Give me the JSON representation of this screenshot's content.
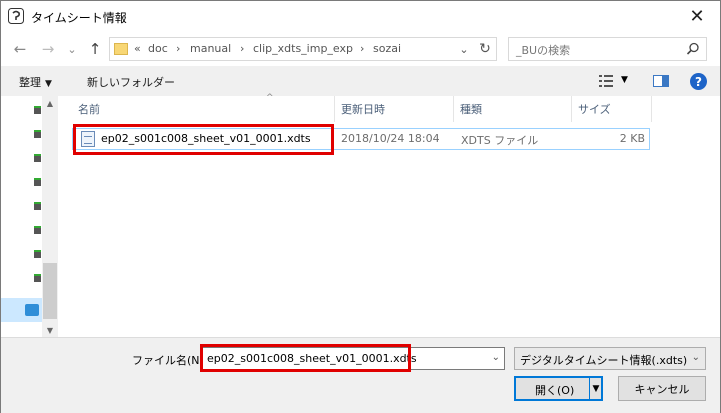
{
  "window": {
    "title": "タイムシート情報",
    "close_glyph": "✕"
  },
  "address": {
    "crumbs": [
      "«",
      "doc",
      "›",
      "manual",
      "›",
      "clip_xdts_imp_exp",
      "›",
      "sozai"
    ],
    "dropdown_glyph": "⌄",
    "refresh_glyph": "↻"
  },
  "search": {
    "placeholder": "_BUの検索"
  },
  "nav": {
    "back": "←",
    "forward": "→",
    "recent": "⌄",
    "up": "↑"
  },
  "toolbar": {
    "organize": "整理",
    "new_folder": "新しいフォルダー",
    "help": "?"
  },
  "columns": [
    "名前",
    "更新日時",
    "種類",
    "サイズ"
  ],
  "files": [
    {
      "name": "ep02_s001c008_sheet_v01_0001.xdts",
      "modified": "2018/10/24 18:04",
      "type": "XDTS ファイル",
      "size": "2 KB"
    }
  ],
  "bottom": {
    "filename_label": "ファイル名(N):",
    "filename_value": "ep02_s001c008_sheet_v01_0001.xdts",
    "filetype_value": "デジタルタイムシート情報(.xdts)",
    "open_label": "開く(O)",
    "cancel_label": "キャンセル"
  },
  "colors": {
    "highlight_red": "#e00000",
    "accent_blue": "#0078d7"
  }
}
